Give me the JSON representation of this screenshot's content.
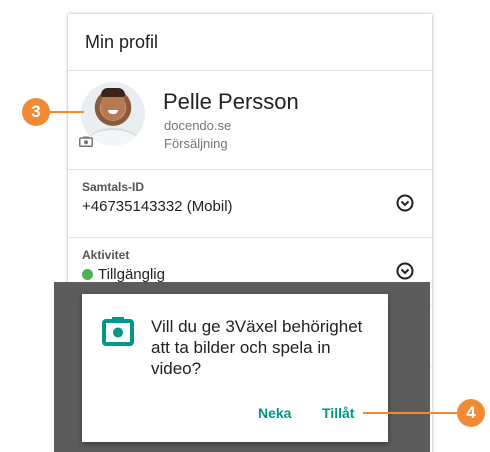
{
  "appbar": {
    "title": "Min profil"
  },
  "profile": {
    "name": "Pelle Persson",
    "org": "docendo.se",
    "department": "Försäljning",
    "avatar_camera_icon": "camera-icon"
  },
  "call_id": {
    "label": "Samtals-ID",
    "value": "+46735143332 (Mobil)",
    "chevron_icon": "chevron-down-circle-icon"
  },
  "activity": {
    "label": "Aktivitet",
    "value": "Tillgänglig",
    "status_color": "#4caf50",
    "chevron_icon": "chevron-down-circle-icon"
  },
  "permission_dialog": {
    "icon": "camera-icon",
    "message": "Vill du ge 3Växel behörighet att ta bilder och spela in video?",
    "deny_label": "Neka",
    "allow_label": "Tillåt",
    "accent_color": "#009688"
  },
  "callouts": {
    "first": "3",
    "second": "4",
    "color": "#f08a35"
  }
}
